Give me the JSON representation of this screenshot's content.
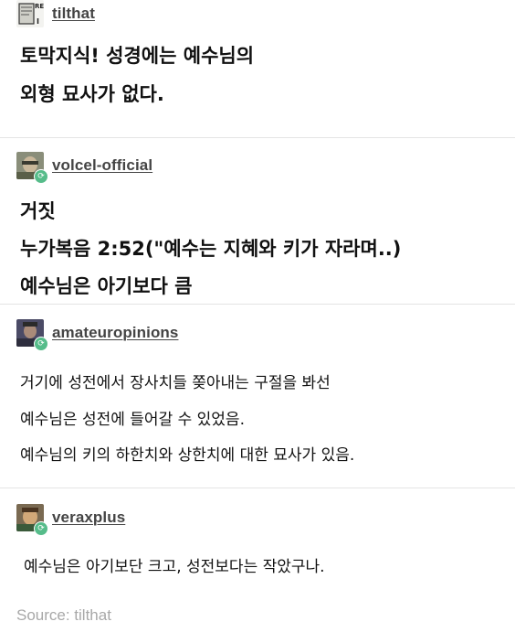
{
  "posts": [
    {
      "username": "tilthat",
      "avatar_icon": "book-avatar-icon",
      "lines": [
        "토막지식! 성경에는 예수님의",
        "외형 묘사가 없다."
      ]
    },
    {
      "username": "volcel-official",
      "avatar_icon": "person-avatar-icon",
      "lines": [
        "거짓",
        "누가복음 2:52(\"예수는 지혜와 키가 자라며..)",
        "예수님은 아기보다 큼"
      ]
    },
    {
      "username": "amateuropinions",
      "avatar_icon": "person-avatar-icon",
      "lines": [
        "거기에 성전에서 장사치들 쫒아내는 구절을 봐선",
        "예수님은 성전에 들어갈 수 있었음.",
        "예수님의 키의 하한치와 상한치에 대한 묘사가 있음."
      ]
    },
    {
      "username": "veraxplus",
      "avatar_icon": "person-avatar-icon",
      "lines": [
        "예수님은 아기보단 크고, 성전보다는 작았구나."
      ]
    }
  ],
  "source_label": "Source: tilthat",
  "colors": {
    "reblog_badge": "#56bc8a",
    "username": "#444444",
    "source": "#a8a8a8"
  }
}
